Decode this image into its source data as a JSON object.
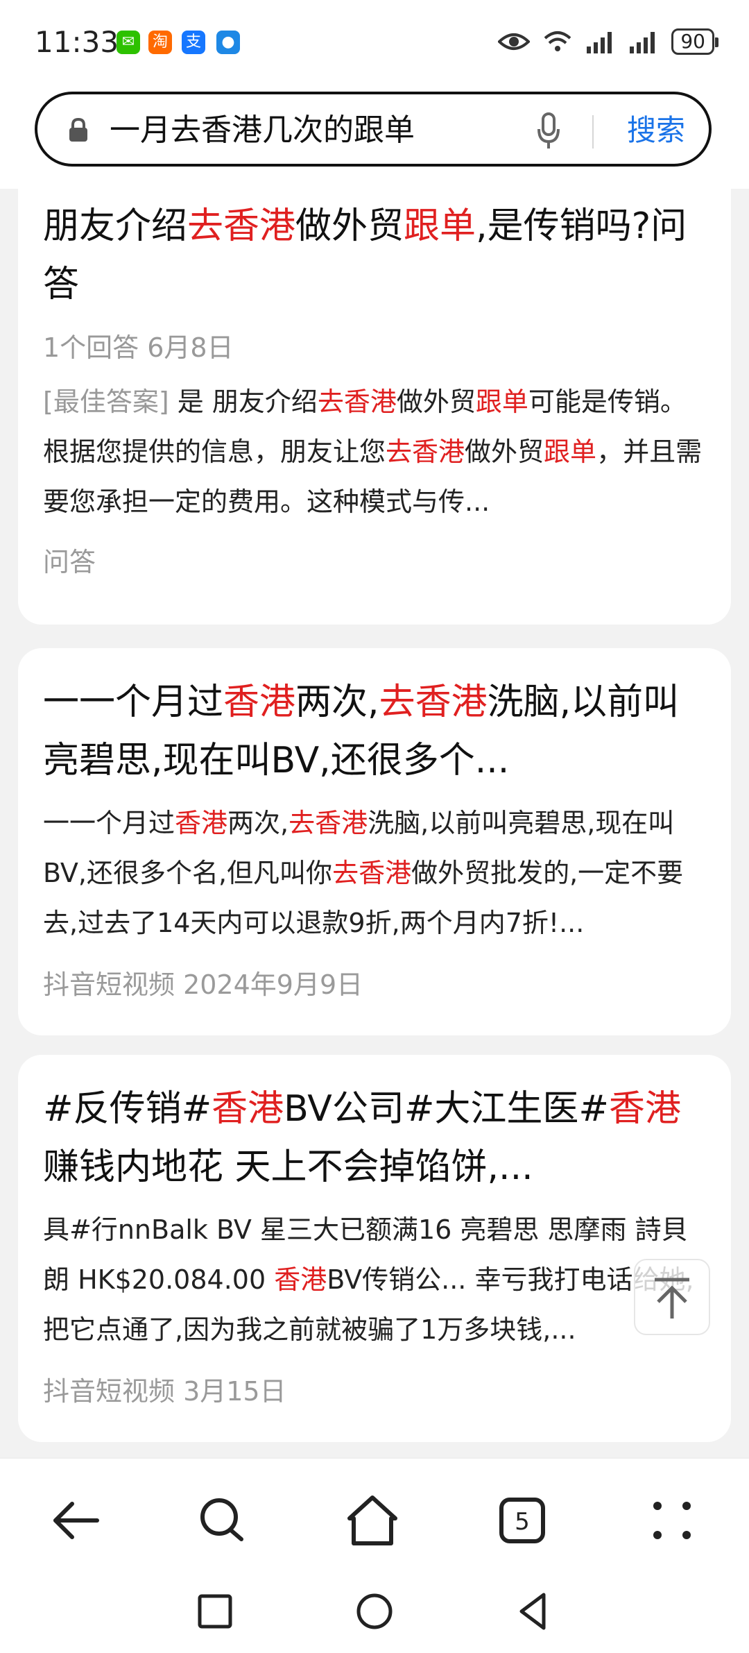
{
  "status_bar": {
    "time": "11:33",
    "apps": [
      {
        "icon": "wechat-icon",
        "color": "#2dc100",
        "glyph": "✉"
      },
      {
        "icon": "taobao-icon",
        "color": "#ff6a00",
        "glyph": "淘"
      },
      {
        "icon": "alipay-icon",
        "color": "#1677ff",
        "glyph": "支"
      },
      {
        "icon": "message-icon",
        "color": "#1e88e5",
        "glyph": "●"
      }
    ],
    "battery": "90"
  },
  "search_bar": {
    "query": "一月去香港几次的跟单",
    "search_button": "搜索"
  },
  "results": [
    {
      "title_parts": [
        {
          "text": "朋友介绍",
          "hl": false
        },
        {
          "text": "去香港",
          "hl": true
        },
        {
          "text": "做外贸",
          "hl": false
        },
        {
          "text": "跟单",
          "hl": true
        },
        {
          "text": ",是传销吗?问答",
          "hl": false
        }
      ],
      "meta": "1个回答   6月8日",
      "snippet_parts": [
        {
          "text": "[最佳答案] ",
          "hl": false,
          "grey": true
        },
        {
          "text": "是 朋友介绍",
          "hl": false
        },
        {
          "text": "去香港",
          "hl": true
        },
        {
          "text": "做外贸",
          "hl": false
        },
        {
          "text": "跟单",
          "hl": true
        },
        {
          "text": "可能是传销。 根据您提供的信息，朋友让您",
          "hl": false
        },
        {
          "text": "去香港",
          "hl": true
        },
        {
          "text": "做外贸",
          "hl": false
        },
        {
          "text": "跟单",
          "hl": true
        },
        {
          "text": "，并且需要您承担一定的费用。这种模式与传...",
          "hl": false
        }
      ],
      "source": "问答"
    },
    {
      "title_parts": [
        {
          "text": "一一个月过",
          "hl": false
        },
        {
          "text": "香港",
          "hl": true
        },
        {
          "text": "两次,",
          "hl": false
        },
        {
          "text": "去香港",
          "hl": true
        },
        {
          "text": "洗脑,以前叫亮碧思,现在叫BV,还很多个...",
          "hl": false
        }
      ],
      "snippet_parts": [
        {
          "text": "一一个月过",
          "hl": false
        },
        {
          "text": "香港",
          "hl": true
        },
        {
          "text": "两次,",
          "hl": false
        },
        {
          "text": "去香港",
          "hl": true
        },
        {
          "text": "洗脑,以前叫亮碧思,现在叫BV,还很多个名,但凡叫你",
          "hl": false
        },
        {
          "text": "去香港",
          "hl": true
        },
        {
          "text": "做外贸批发的,一定不要去,过去了14天内可以退款9折,两个月内7折!...",
          "hl": false
        }
      ],
      "source": "抖音短视频   2024年9月9日"
    },
    {
      "title_parts": [
        {
          "text": "#反传销#",
          "hl": false
        },
        {
          "text": "香港",
          "hl": true
        },
        {
          "text": "BV公司#大江生医#",
          "hl": false
        },
        {
          "text": "香港",
          "hl": true
        },
        {
          "text": "赚钱内地花 天上不会掉馅饼,...",
          "hl": false
        }
      ],
      "snippet_parts": [
        {
          "text": "具#行nnBalk BV 星三大已额满16 亮碧思 思摩雨 詩貝朗 HK$20.084.00 ",
          "hl": false
        },
        {
          "text": "香港",
          "hl": true
        },
        {
          "text": "BV传销公... 幸亏我打电话给她,把它点通了,因为我之前就被骗了1万多块钱,...",
          "hl": false
        }
      ],
      "source": "抖音短视频   3月15日"
    }
  ],
  "nav_bar": {
    "back": "back-icon",
    "search": "search-icon",
    "home": "home-icon",
    "tabs_count": "5",
    "menu": "menu-icon"
  },
  "colors": {
    "highlight": "#e02020",
    "accent": "#1a73e8",
    "meta": "#999999"
  }
}
